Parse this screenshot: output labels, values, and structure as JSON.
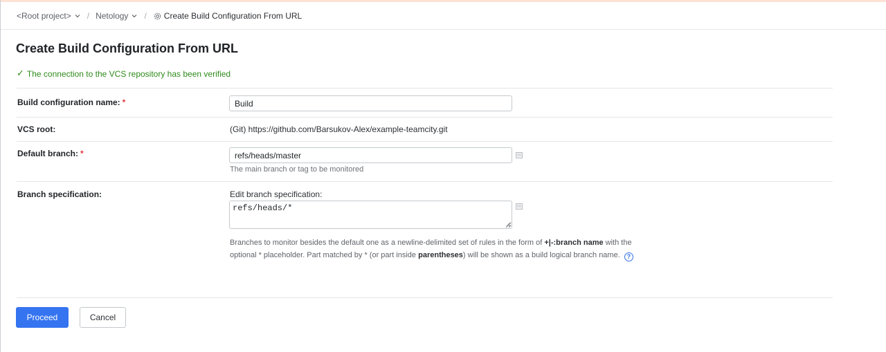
{
  "breadcrumb": {
    "root": "<Root project>",
    "project": "Netology",
    "separator": "/",
    "current": "Create Build Configuration From URL"
  },
  "page": {
    "title": "Create Build Configuration From URL",
    "verified_message": "The connection to the VCS repository has been verified",
    "verified_check": "✓"
  },
  "form": {
    "required_marker": "*",
    "build_name": {
      "label": "Build configuration name:",
      "value": "Build"
    },
    "vcs_root": {
      "label": "VCS root:",
      "value": "(Git) https://github.com/Barsukov-Alex/example-teamcity.git"
    },
    "default_branch": {
      "label": "Default branch:",
      "value": "refs/heads/master",
      "hint": "The main branch or tag to be monitored"
    },
    "branch_spec": {
      "label": "Branch specification:",
      "edit_label": "Edit branch specification:",
      "value": "refs/heads/*",
      "desc_part1": "Branches to monitor besides the default one as a newline-delimited set of rules in the form of ",
      "desc_bold1": "+|-:branch name",
      "desc_part2": " with the optional * placeholder. Part matched by * (or part inside ",
      "desc_bold2": "parentheses",
      "desc_part3": ") will be shown as a build logical branch name.",
      "help": "?"
    }
  },
  "buttons": {
    "proceed": "Proceed",
    "cancel": "Cancel"
  },
  "colors": {
    "primary": "#3574f0",
    "success": "#2e8a1a",
    "required": "#e0393e"
  },
  "icons": [
    "chevron-down-icon",
    "gear-icon",
    "checkmark-icon",
    "expand-editor-icon",
    "resize-grip-icon",
    "help-icon"
  ]
}
